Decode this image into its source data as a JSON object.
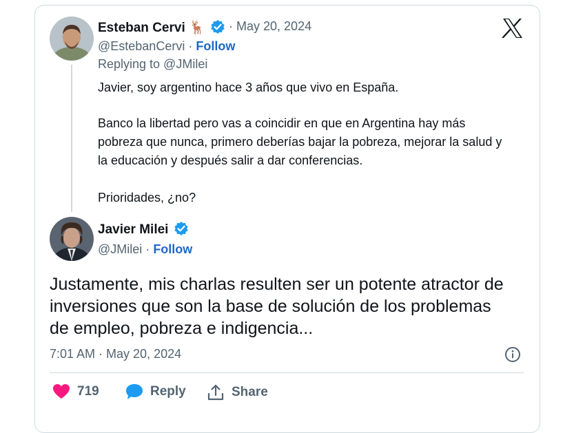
{
  "quoted_tweet": {
    "author_name": "Esteban Cervi",
    "author_emoji": "🦌",
    "date": "May 20, 2024",
    "handle": "@EstebanCervi",
    "separator": "·",
    "follow_label": "Follow",
    "replying_to": "Replying to @JMilei",
    "paragraphs": [
      "Javier, soy argentino hace 3 años que vivo en España.",
      "Banco la libertad pero vas a coincidir en que en Argentina hay más pobreza que nunca, primero deberías bajar la pobreza, mejorar la salud y la educación  y después salir a dar conferencias.",
      "Prioridades, ¿no?"
    ]
  },
  "main_tweet": {
    "author_name": "Javier Milei",
    "handle": "@JMilei",
    "separator": "·",
    "follow_label": "Follow",
    "text": "Justamente, mis charlas resulten ser un potente atractor de inversiones que son la base de solución de los problemas de empleo, pobreza e indigencia...",
    "timestamp": "7:01 AM · May 20, 2024"
  },
  "actions": {
    "like_count": "719",
    "reply_label": "Reply",
    "share_label": "Share"
  },
  "colors": {
    "verified": "#1d9bf0",
    "like": "#f91880",
    "reply_icon": "#1d9bf0",
    "follow": "#1d68c9"
  }
}
